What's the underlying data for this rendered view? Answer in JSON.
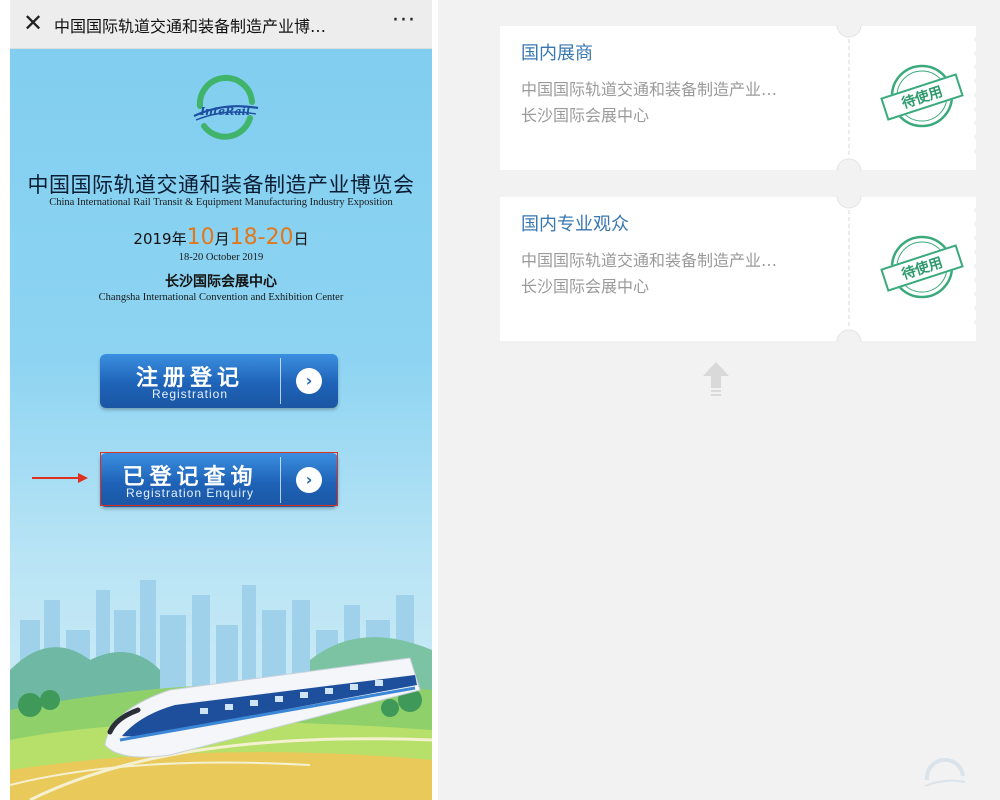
{
  "left": {
    "topbar": {
      "close_icon": "close-icon",
      "title": "中国国际轨道交通和装备制造产业博…",
      "more_icon": "more-dots-icon",
      "more_glyph": "···"
    },
    "logo": {
      "text": "InteRail"
    },
    "header": {
      "title_cn": "中国国际轨道交通和装备制造产业博览会",
      "title_en": "China International Rail Transit & Equipment Manufacturing Industry Exposition",
      "date_cn": {
        "year": "2019年",
        "month": "10",
        "month_suffix": "月",
        "days": "18-20",
        "day_suffix": "日"
      },
      "date_en": "18-20 October 2019",
      "venue_cn": "长沙国际会展中心",
      "venue_en": "Changsha International Convention and Exhibition Center"
    },
    "buttons": {
      "registration": {
        "cn": "注册登记",
        "en": "Registration"
      },
      "enquiry": {
        "cn": "已登记查询",
        "en": "Registration Enquiry"
      }
    },
    "colors": {
      "accent_orange": "#e0781c",
      "button_blue": "#1e63b8",
      "highlight_red": "#e0301e"
    }
  },
  "right": {
    "tickets": [
      {
        "title": "国内展商",
        "line1": "中国国际轨道交通和装备制造产业…",
        "line2": "长沙国际会展中心",
        "stamp": "待使用"
      },
      {
        "title": "国内专业观众",
        "line1": "中国国际轨道交通和装备制造产业…",
        "line2": "长沙国际会展中心",
        "stamp": "待使用"
      }
    ],
    "colors": {
      "title_blue": "#3877b0",
      "stamp_green": "#3aaa7c"
    }
  }
}
